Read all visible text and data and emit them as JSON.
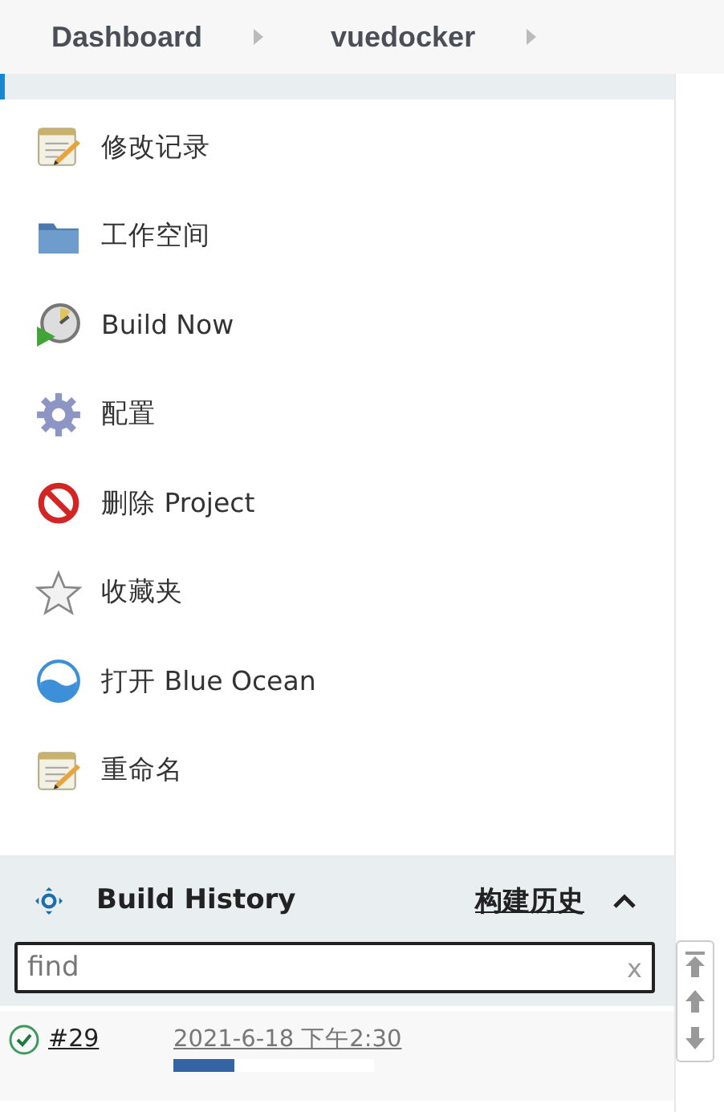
{
  "breadcrumbs": [
    {
      "label": "Dashboard"
    },
    {
      "label": "vuedocker"
    }
  ],
  "tasks": [
    {
      "label": "修改记录",
      "kind": "notepad"
    },
    {
      "label": "工作空间",
      "kind": "folder"
    },
    {
      "label": "Build Now",
      "kind": "build"
    },
    {
      "label": "配置",
      "kind": "gear"
    },
    {
      "label": "删除 Project",
      "kind": "delete"
    },
    {
      "label": "收藏夹",
      "kind": "star"
    },
    {
      "label": "打开 Blue Ocean",
      "kind": "ocean"
    },
    {
      "label": "重命名",
      "kind": "notepad"
    }
  ],
  "build_history": {
    "title": "Build History",
    "link": "构建历史",
    "expanded": true,
    "search": {
      "placeholder": "find",
      "clear": "x"
    },
    "builds": [
      {
        "number": "#29",
        "date": "2021-6-18 下午2:30",
        "succeeded": true,
        "level": 0.3
      }
    ]
  }
}
